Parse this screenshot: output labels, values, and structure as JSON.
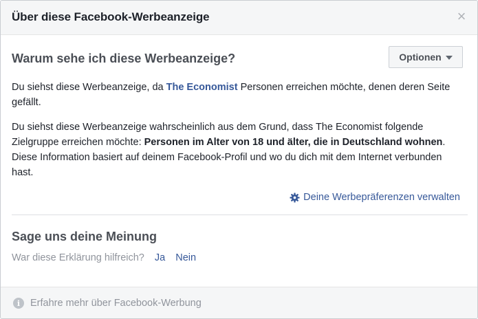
{
  "dialog": {
    "title": "Über diese Facebook-Werbeanzeige",
    "close_icon": "close-icon",
    "close_glyph": "×"
  },
  "why": {
    "title": "Warum sehe ich diese Werbeanzeige?",
    "options_label": "Optionen",
    "p1_before": "Du siehst diese Werbeanzeige, da ",
    "p1_advertiser": "The Economist",
    "p1_after": " Personen erreichen möchte, denen deren Seite gefällt.",
    "p2_before": "Du siehst diese Werbeanzeige wahrscheinlich aus dem Grund, dass The Economist folgende Zielgruppe erreichen möchte: ",
    "p2_bold": "Personen im Alter von 18 und älter, die in Deutschland wohnen",
    "p2_after": ". Diese Information basiert auf deinem Facebook-Profil und wo du dich mit dem Internet verbunden hast.",
    "prefs_link": "Deine Werbepräferenzen verwalten",
    "prefs_icon": "gear-icon"
  },
  "feedback": {
    "title": "Sage uns deine Meinung",
    "question": "War diese Erklärung hilfreich?",
    "yes": "Ja",
    "no": "Nein"
  },
  "footer": {
    "link": "Erfahre mehr über Facebook-Werbung",
    "icon": "info-icon",
    "icon_glyph": "i"
  },
  "colors": {
    "link": "#365899",
    "header_bg": "#f5f6f7",
    "muted_text": "#90949c",
    "body_text": "#1d2129"
  }
}
